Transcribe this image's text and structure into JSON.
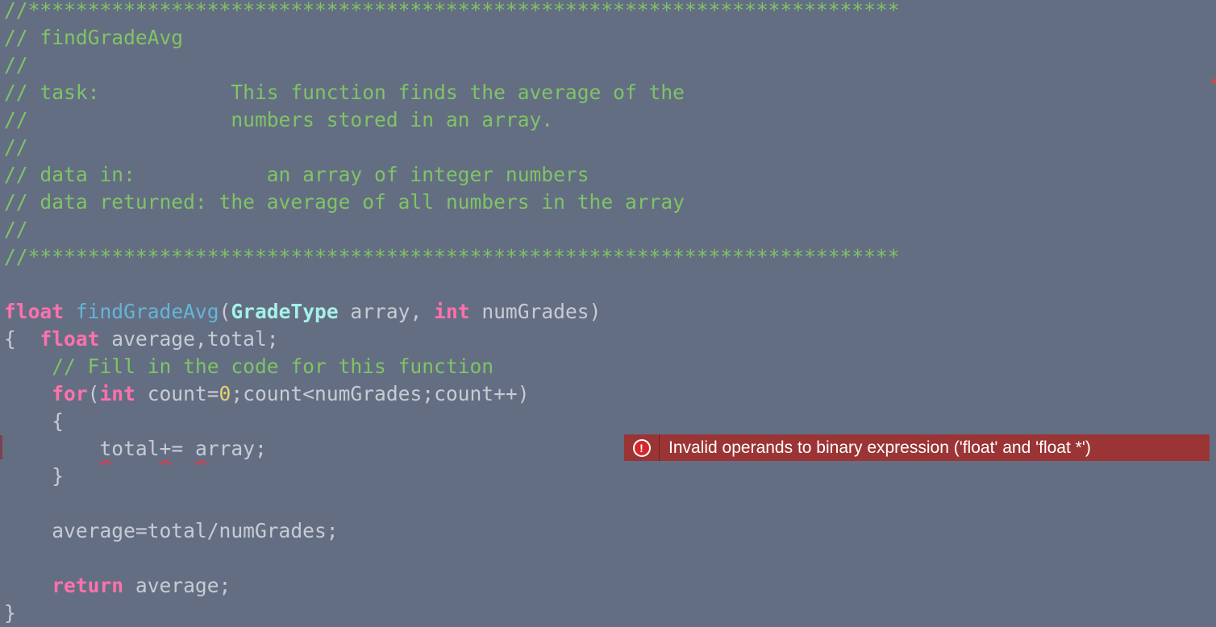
{
  "editor": {
    "lines": [
      {
        "segments": [
          {
            "c": "cm",
            "t": "//*************************************************************************"
          }
        ]
      },
      {
        "segments": [
          {
            "c": "cm",
            "t": "// findGradeAvg"
          }
        ]
      },
      {
        "segments": [
          {
            "c": "cm",
            "t": "//"
          }
        ]
      },
      {
        "segments": [
          {
            "c": "cm",
            "t": "// task:           This function finds the average of the"
          }
        ]
      },
      {
        "segments": [
          {
            "c": "cm",
            "t": "//                 numbers stored in an array."
          }
        ]
      },
      {
        "segments": [
          {
            "c": "cm",
            "t": "//"
          }
        ]
      },
      {
        "segments": [
          {
            "c": "cm",
            "t": "// data in:           an array of integer numbers"
          }
        ]
      },
      {
        "segments": [
          {
            "c": "cm",
            "t": "// data returned: the average of all numbers in the array"
          }
        ]
      },
      {
        "segments": [
          {
            "c": "cm",
            "t": "//"
          }
        ]
      },
      {
        "segments": [
          {
            "c": "cm",
            "t": "//*************************************************************************"
          }
        ]
      },
      {
        "segments": []
      },
      {
        "segments": [
          {
            "c": "kw",
            "t": "float"
          },
          {
            "c": "pl",
            "t": " "
          },
          {
            "c": "fn",
            "t": "findGradeAvg"
          },
          {
            "c": "pl",
            "t": "("
          },
          {
            "c": "ty",
            "t": "GradeType"
          },
          {
            "c": "pl",
            "t": " array, "
          },
          {
            "c": "kw",
            "t": "int"
          },
          {
            "c": "pl",
            "t": " numGrades)"
          }
        ]
      },
      {
        "segments": [
          {
            "c": "pl",
            "t": "{  "
          },
          {
            "c": "kw",
            "t": "float"
          },
          {
            "c": "pl",
            "t": " average,total;"
          }
        ]
      },
      {
        "segments": [
          {
            "c": "pl",
            "t": "    "
          },
          {
            "c": "cm",
            "t": "// Fill in the code for this function"
          }
        ]
      },
      {
        "segments": [
          {
            "c": "pl",
            "t": "    "
          },
          {
            "c": "kw",
            "t": "for"
          },
          {
            "c": "pl",
            "t": "("
          },
          {
            "c": "kw",
            "t": "int"
          },
          {
            "c": "pl",
            "t": " count="
          },
          {
            "c": "num",
            "t": "0"
          },
          {
            "c": "pl",
            "t": ";count<numGrades;count++)"
          }
        ]
      },
      {
        "segments": [
          {
            "c": "pl",
            "t": "    {"
          }
        ]
      },
      {
        "segments": [
          {
            "c": "pl",
            "t": "        "
          },
          {
            "c": "pl squig",
            "t": "t"
          },
          {
            "c": "pl",
            "t": "otal"
          },
          {
            "c": "pl squig",
            "t": "+"
          },
          {
            "c": "pl",
            "t": "= "
          },
          {
            "c": "pl squig",
            "t": "a"
          },
          {
            "c": "pl",
            "t": "rray;"
          }
        ]
      },
      {
        "segments": [
          {
            "c": "pl",
            "t": "    }"
          }
        ]
      },
      {
        "segments": []
      },
      {
        "segments": [
          {
            "c": "pl",
            "t": "    average=total/numGrades;"
          }
        ]
      },
      {
        "segments": []
      },
      {
        "segments": [
          {
            "c": "pl",
            "t": "    "
          },
          {
            "c": "kw",
            "t": "return"
          },
          {
            "c": "pl",
            "t": " average;"
          }
        ]
      },
      {
        "segments": [
          {
            "c": "pl",
            "t": "}"
          }
        ]
      }
    ]
  },
  "error": {
    "icon": "error-circle-icon",
    "icon_glyph": "!",
    "message": "Invalid operands to binary expression ('float' and 'float *')"
  },
  "colors": {
    "background": "#646e83",
    "comment": "#7fc465",
    "keyword": "#ff71ac",
    "function": "#64b5d8",
    "type": "#a5f1e8",
    "number": "#e6d36b",
    "plain": "#c7cbd4",
    "error_banner": "#9b3535"
  }
}
